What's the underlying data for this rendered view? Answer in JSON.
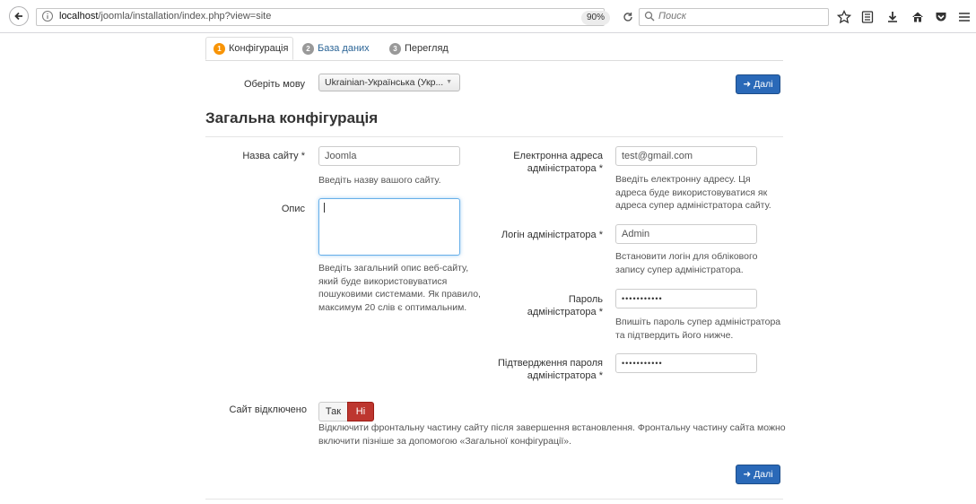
{
  "browser": {
    "url_host": "localhost",
    "url_path": "/joomla/installation/index.php?view=site",
    "zoom": "90%",
    "search_placeholder": "Поиск"
  },
  "tabs": [
    {
      "num": "1",
      "label": "Конфігурація"
    },
    {
      "num": "2",
      "label": "База даних"
    },
    {
      "num": "3",
      "label": "Перегляд"
    }
  ],
  "language": {
    "label": "Оберіть мову",
    "selected": "Ukrainian-Українська (Укр..."
  },
  "next_label": "Далі",
  "section_title": "Загальна конфігурація",
  "form": {
    "site_name": {
      "label": "Назва сайту *",
      "value": "Joomla",
      "help": "Введіть назву вашого сайту."
    },
    "description": {
      "label": "Опис",
      "help": "Введіть загальний опис веб-сайту, який буде використовуватися пошуковими системами. Як правило, максимум 20 слів є оптимальним."
    },
    "admin_email": {
      "label": "Електронна адреса адміністратора *",
      "value": "test@gmail.com",
      "help": "Введіть електронну адресу. Ця адреса буде використовуватися як адреса супер адміністратора сайту."
    },
    "admin_login": {
      "label": "Логін адміністратора *",
      "value": "Admin",
      "help": "Встановити логін для облікового запису супер адміністратора."
    },
    "admin_password": {
      "label": "Пароль адміністратора *",
      "value": "•••••••••••",
      "help": "Впишіть пароль супер адміністратора та підтвердить його нижче."
    },
    "admin_password_confirm": {
      "label": "Підтвердження пароля адміністратора *",
      "value": "•••••••••••"
    },
    "site_offline": {
      "label": "Сайт відключено",
      "yes": "Так",
      "no": "Ні",
      "help": "Відключити фронтальну частину сайту після завершення встановлення. Фронтальну частину сайта можно включити пізніше за допомогою «Загальної конфігурації»."
    }
  },
  "colors": {
    "primary": "#2a69b8",
    "danger": "#bd362f",
    "step_active": "#f89406"
  }
}
